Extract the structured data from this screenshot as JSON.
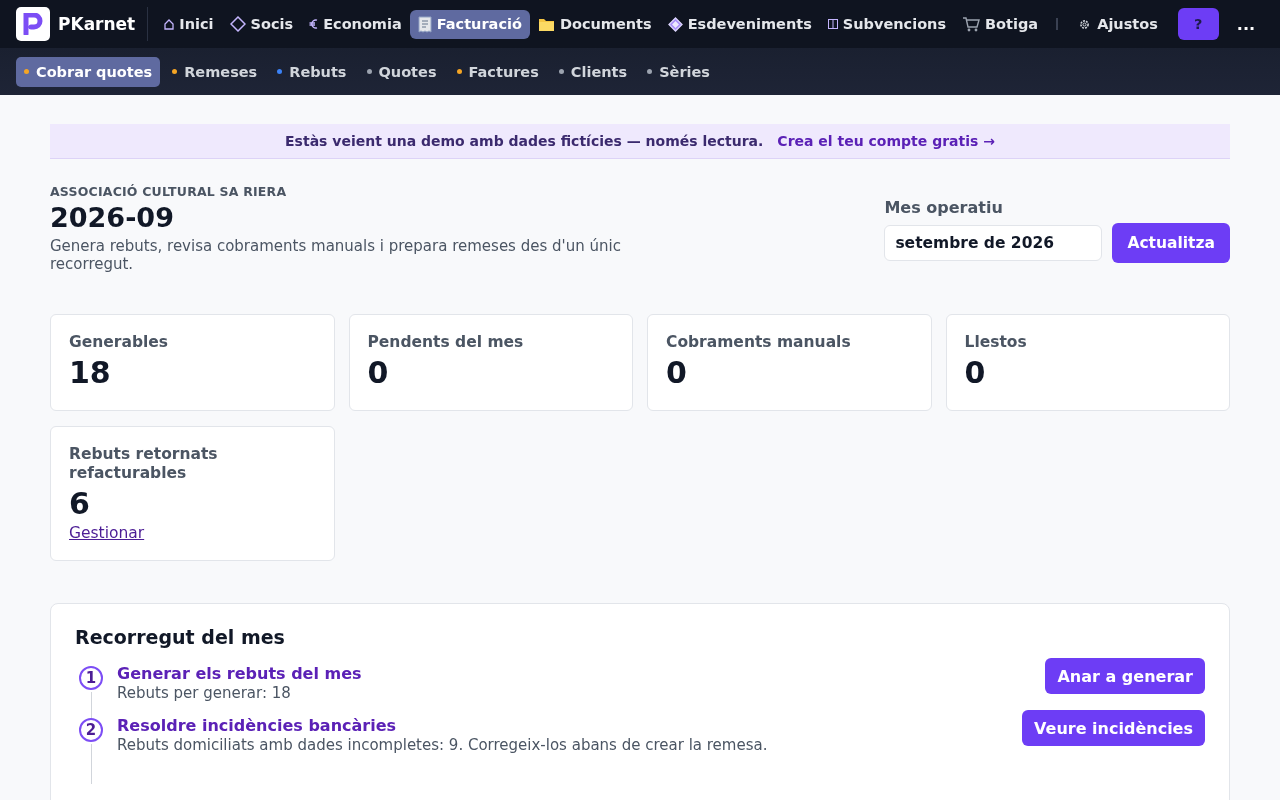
{
  "topnav": {
    "brand": "PKarnet",
    "items": [
      {
        "label": "Inici",
        "selected": false
      },
      {
        "label": "Socis",
        "selected": false
      },
      {
        "label": "Economia",
        "selected": false
      },
      {
        "label": "Facturació",
        "selected": true
      },
      {
        "label": "Documents",
        "selected": false
      },
      {
        "label": "Esdeveniments",
        "selected": false
      },
      {
        "label": "Subvencions",
        "selected": false
      },
      {
        "label": "Botiga",
        "selected": false
      }
    ],
    "settings": "Ajustos",
    "help": "?",
    "more": "..."
  },
  "subnav": [
    {
      "label": "Cobrar quotes",
      "selected": true,
      "color": "#f5a524"
    },
    {
      "label": "Remeses",
      "selected": false,
      "color": "#f5a524"
    },
    {
      "label": "Rebuts",
      "selected": false,
      "color": "#3b82f6"
    },
    {
      "label": "Quotes",
      "selected": false,
      "color": "#9ca3af"
    },
    {
      "label": "Factures",
      "selected": false,
      "color": "#f5a524"
    },
    {
      "label": "Clients",
      "selected": false,
      "color": "#9ca3af"
    },
    {
      "label": "Sèries",
      "selected": false,
      "color": "#9ca3af"
    }
  ],
  "banner": {
    "text": "Estàs veient una demo amb dades fictícies — només lectura.",
    "link": "Crea el teu compte gratis →"
  },
  "header": {
    "org": "ASSOCIACIÓ CULTURAL SA RIERA",
    "title": "2026-09",
    "description": "Genera rebuts, revisa cobraments manuals i prepara remeses des d'un únic recorregut.",
    "month_label": "Mes operatiu",
    "month_value": "setembre de 2026",
    "update_button": "Actualitza"
  },
  "stats": [
    {
      "label": "Generables",
      "value": "18"
    },
    {
      "label": "Pendents del mes",
      "value": "0"
    },
    {
      "label": "Cobraments manuals",
      "value": "0"
    },
    {
      "label": "Llestos",
      "value": "0"
    },
    {
      "label": "Rebuts retornats refacturables",
      "value": "6",
      "link": "Gestionar"
    }
  ],
  "walkthrough": {
    "title": "Recorregut del mes",
    "steps": [
      {
        "number": "1",
        "title": "Generar els rebuts del mes",
        "description": "Rebuts per generar: 18",
        "button": "Anar a generar"
      },
      {
        "number": "2",
        "title": "Resoldre incidències bancàries",
        "description": "Rebuts domiciliats amb dades incompletes: 9. Corregeix-los abans de crear la remesa.",
        "button": "Veure incidències"
      }
    ]
  }
}
